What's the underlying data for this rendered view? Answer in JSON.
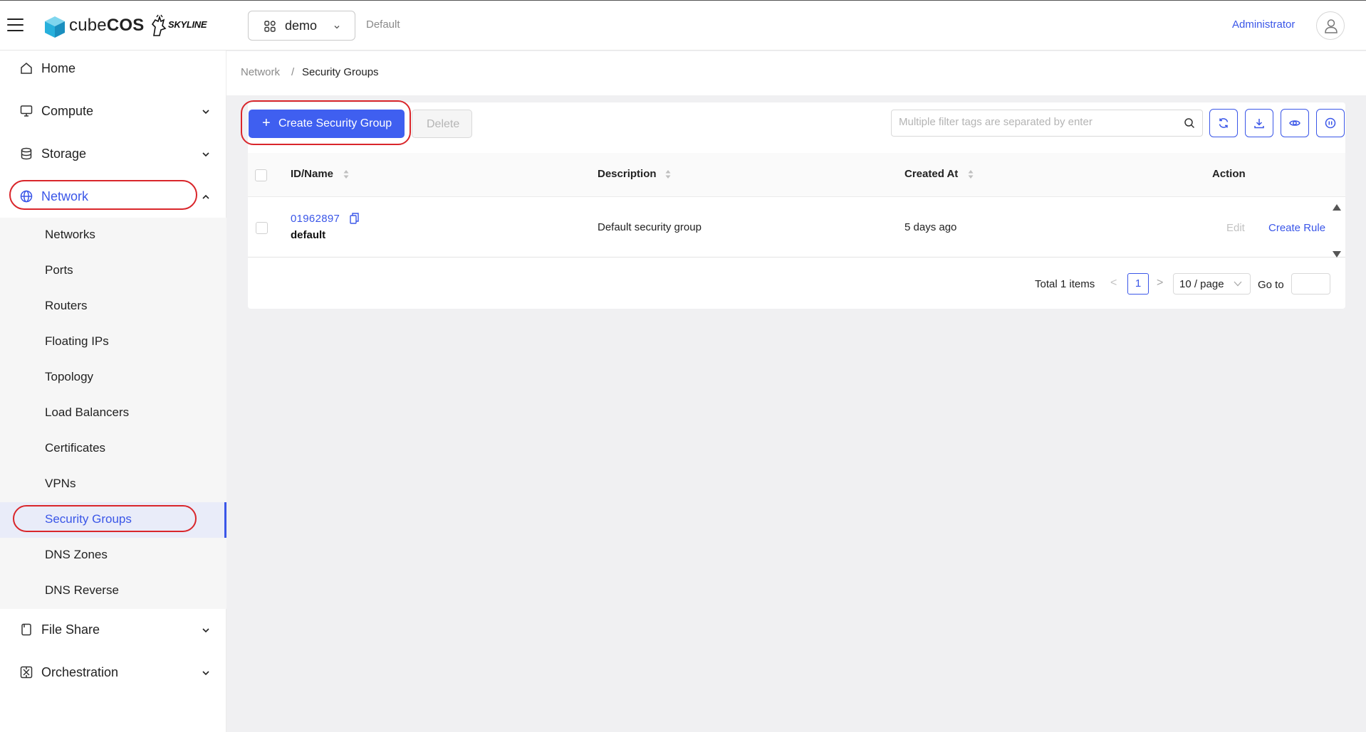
{
  "header": {
    "brand_light": "cube",
    "brand_bold": "COS",
    "partner_logo": "SKYLINE",
    "project": "demo",
    "domain": "Default",
    "user": "Administrator"
  },
  "sidebar": {
    "items": [
      {
        "label": "Home",
        "icon": "home-icon"
      },
      {
        "label": "Compute",
        "icon": "monitor-icon"
      },
      {
        "label": "Storage",
        "icon": "database-icon"
      },
      {
        "label": "Network",
        "icon": "globe-icon"
      },
      {
        "label": "File Share",
        "icon": "file-icon"
      },
      {
        "label": "Orchestration",
        "icon": "orchestration-icon"
      }
    ],
    "network_children": [
      "Networks",
      "Ports",
      "Routers",
      "Floating IPs",
      "Topology",
      "Load Balancers",
      "Certificates",
      "VPNs",
      "Security Groups",
      "DNS Zones",
      "DNS Reverse"
    ],
    "active_child": "Security Groups"
  },
  "breadcrumb": {
    "parent": "Network",
    "separator": "/",
    "current": "Security Groups"
  },
  "toolbar": {
    "create_label": "Create Security Group",
    "delete_label": "Delete",
    "search_placeholder": "Multiple filter tags are separated by enter"
  },
  "table": {
    "columns": [
      "ID/Name",
      "Description",
      "Created At",
      "Action"
    ],
    "rows": [
      {
        "id": "01962897",
        "name": "default",
        "description": "Default security group",
        "created_at": "5 days ago",
        "actions": [
          "Edit",
          "Create Rule"
        ]
      }
    ]
  },
  "pagination": {
    "total": "Total 1 items",
    "prev": "<",
    "page": "1",
    "next": ">",
    "page_size": "10 / page",
    "goto": "Go to"
  },
  "colors": {
    "accent": "#3a56e8",
    "button": "#3f5ff0",
    "annotation": "#d9262b"
  }
}
